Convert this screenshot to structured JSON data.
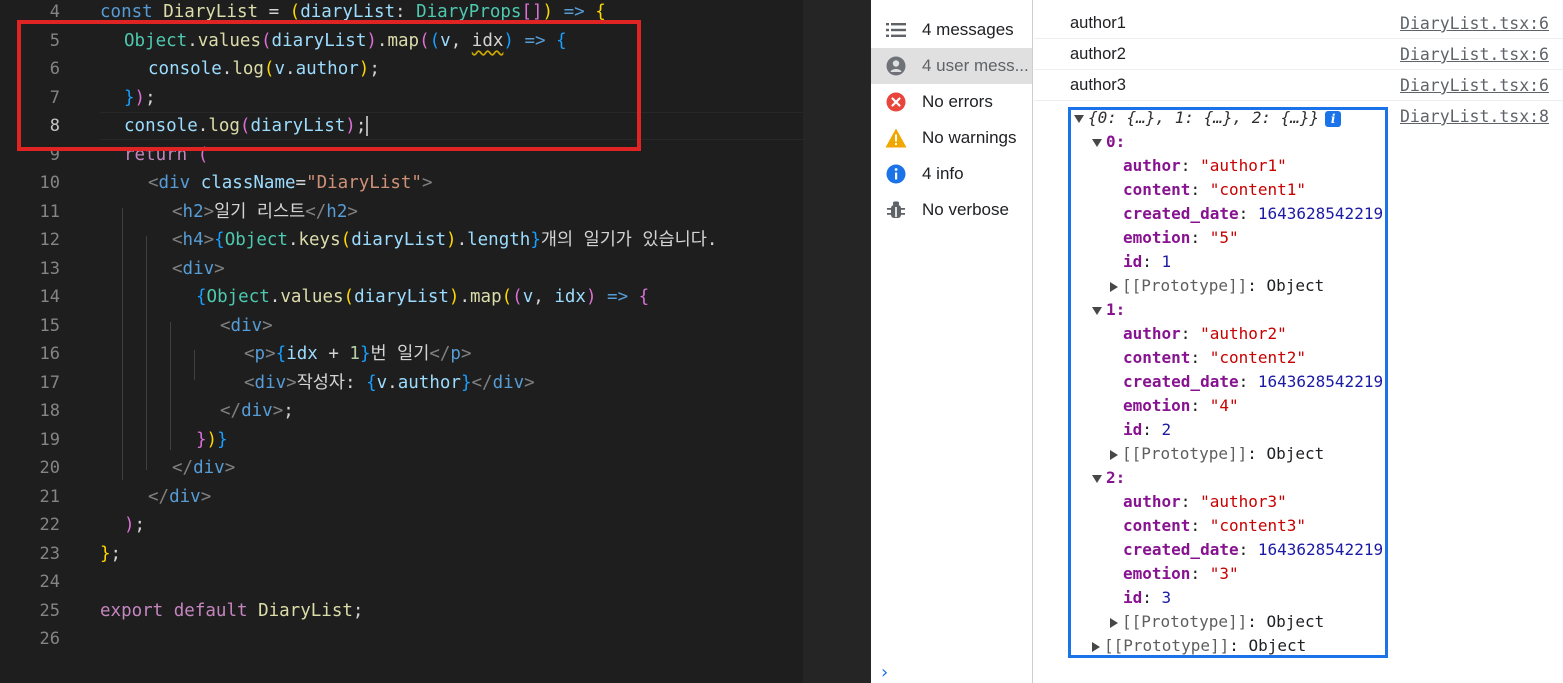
{
  "editor": {
    "lines": [
      {
        "n": "4",
        "segs": [
          [
            "kw",
            "const "
          ],
          [
            "fn",
            "DiaryList"
          ],
          [
            "txt",
            " = "
          ],
          [
            "br1",
            "("
          ],
          [
            "var",
            "diaryList"
          ],
          [
            "txt",
            ": "
          ],
          [
            "typ",
            "DiaryProps"
          ],
          [
            "br2",
            "[]"
          ],
          [
            "br1",
            ")"
          ],
          [
            "txt",
            " "
          ],
          [
            "kw",
            "=>"
          ],
          [
            "txt",
            " "
          ],
          [
            "br1",
            "{"
          ]
        ]
      },
      {
        "n": "5",
        "segs": [
          [
            "typ",
            "Object"
          ],
          [
            "txt",
            "."
          ],
          [
            "fn",
            "values"
          ],
          [
            "br2",
            "("
          ],
          [
            "var",
            "diaryList"
          ],
          [
            "br2",
            ")"
          ],
          [
            "txt",
            "."
          ],
          [
            "fn",
            "map"
          ],
          [
            "br2",
            "("
          ],
          [
            "br3",
            "("
          ],
          [
            "var",
            "v"
          ],
          [
            "txt",
            ", "
          ],
          [
            "squig",
            "idx"
          ],
          [
            "br3",
            ")"
          ],
          [
            "txt",
            " "
          ],
          [
            "kw",
            "=>"
          ],
          [
            "txt",
            " "
          ],
          [
            "br3",
            "{"
          ]
        ]
      },
      {
        "n": "6",
        "segs": [
          [
            "var",
            "console"
          ],
          [
            "txt",
            "."
          ],
          [
            "fn",
            "log"
          ],
          [
            "br1",
            "("
          ],
          [
            "var",
            "v"
          ],
          [
            "txt",
            "."
          ],
          [
            "var",
            "author"
          ],
          [
            "br1",
            ")"
          ],
          [
            "txt",
            ";"
          ]
        ]
      },
      {
        "n": "7",
        "segs": [
          [
            "br3",
            "}"
          ],
          [
            "br2",
            ")"
          ],
          [
            "txt",
            ";"
          ]
        ]
      },
      {
        "n": "8",
        "segs": [
          [
            "var",
            "console"
          ],
          [
            "txt",
            "."
          ],
          [
            "fn",
            "log"
          ],
          [
            "br2",
            "("
          ],
          [
            "var",
            "diaryList"
          ],
          [
            "br2",
            ")"
          ],
          [
            "txt",
            ";"
          ],
          [
            "cursor",
            ""
          ]
        ]
      },
      {
        "n": "9",
        "segs": [
          [
            "kw2",
            "return"
          ],
          [
            "txt",
            " "
          ],
          [
            "br2",
            "("
          ]
        ]
      },
      {
        "n": "10",
        "segs": [
          [
            "tagb",
            "<"
          ],
          [
            "tag",
            "div"
          ],
          [
            "txt",
            " "
          ],
          [
            "var",
            "className"
          ],
          [
            "txt",
            "="
          ],
          [
            "str",
            "\"DiaryList\""
          ],
          [
            "tagb",
            ">"
          ]
        ]
      },
      {
        "n": "11",
        "segs": [
          [
            "tagb",
            "<"
          ],
          [
            "tag",
            "h2"
          ],
          [
            "tagb",
            ">"
          ],
          [
            "txt",
            "일기 리스트"
          ],
          [
            "tagb",
            "</"
          ],
          [
            "tag",
            "h2"
          ],
          [
            "tagb",
            ">"
          ]
        ]
      },
      {
        "n": "12",
        "segs": [
          [
            "tagb",
            "<"
          ],
          [
            "tag",
            "h4"
          ],
          [
            "tagb",
            ">"
          ],
          [
            "br3",
            "{"
          ],
          [
            "typ",
            "Object"
          ],
          [
            "txt",
            "."
          ],
          [
            "fn",
            "keys"
          ],
          [
            "br1",
            "("
          ],
          [
            "var",
            "diaryList"
          ],
          [
            "br1",
            ")"
          ],
          [
            "txt",
            "."
          ],
          [
            "var",
            "length"
          ],
          [
            "br3",
            "}"
          ],
          [
            "txt",
            "개의 일기가 있습니다."
          ]
        ]
      },
      {
        "n": "13",
        "segs": [
          [
            "tagb",
            "<"
          ],
          [
            "tag",
            "div"
          ],
          [
            "tagb",
            ">"
          ]
        ]
      },
      {
        "n": "14",
        "segs": [
          [
            "br3",
            "{"
          ],
          [
            "typ",
            "Object"
          ],
          [
            "txt",
            "."
          ],
          [
            "fn",
            "values"
          ],
          [
            "br1",
            "("
          ],
          [
            "var",
            "diaryList"
          ],
          [
            "br1",
            ")"
          ],
          [
            "txt",
            "."
          ],
          [
            "fn",
            "map"
          ],
          [
            "br1",
            "("
          ],
          [
            "br2",
            "("
          ],
          [
            "var",
            "v"
          ],
          [
            "txt",
            ", "
          ],
          [
            "var",
            "idx"
          ],
          [
            "br2",
            ")"
          ],
          [
            "txt",
            " "
          ],
          [
            "kw",
            "=>"
          ],
          [
            "txt",
            " "
          ],
          [
            "br2",
            "{"
          ]
        ]
      },
      {
        "n": "15",
        "segs": [
          [
            "tagb",
            "<"
          ],
          [
            "tag",
            "div"
          ],
          [
            "tagb",
            ">"
          ]
        ]
      },
      {
        "n": "16",
        "segs": [
          [
            "tagb",
            "<"
          ],
          [
            "tag",
            "p"
          ],
          [
            "tagb",
            ">"
          ],
          [
            "br3",
            "{"
          ],
          [
            "var",
            "idx"
          ],
          [
            "txt",
            " + "
          ],
          [
            "num",
            "1"
          ],
          [
            "br3",
            "}"
          ],
          [
            "txt",
            "번 일기"
          ],
          [
            "tagb",
            "</"
          ],
          [
            "tag",
            "p"
          ],
          [
            "tagb",
            ">"
          ]
        ]
      },
      {
        "n": "17",
        "segs": [
          [
            "tagb",
            "<"
          ],
          [
            "tag",
            "div"
          ],
          [
            "tagb",
            ">"
          ],
          [
            "txt",
            "작성자: "
          ],
          [
            "br3",
            "{"
          ],
          [
            "var",
            "v"
          ],
          [
            "txt",
            "."
          ],
          [
            "var",
            "author"
          ],
          [
            "br3",
            "}"
          ],
          [
            "tagb",
            "</"
          ],
          [
            "tag",
            "div"
          ],
          [
            "tagb",
            ">"
          ]
        ]
      },
      {
        "n": "18",
        "segs": [
          [
            "tagb",
            "</"
          ],
          [
            "tag",
            "div"
          ],
          [
            "tagb",
            ">"
          ],
          [
            "txt",
            ";"
          ]
        ]
      },
      {
        "n": "19",
        "segs": [
          [
            "br2",
            "}"
          ],
          [
            "br1",
            ")"
          ],
          [
            "br3",
            "}"
          ]
        ]
      },
      {
        "n": "20",
        "segs": [
          [
            "tagb",
            "</"
          ],
          [
            "tag",
            "div"
          ],
          [
            "tagb",
            ">"
          ]
        ]
      },
      {
        "n": "21",
        "segs": [
          [
            "tagb",
            "</"
          ],
          [
            "tag",
            "div"
          ],
          [
            "tagb",
            ">"
          ]
        ]
      },
      {
        "n": "22",
        "segs": [
          [
            "br2",
            ")"
          ],
          [
            "txt",
            ";"
          ]
        ]
      },
      {
        "n": "23",
        "segs": [
          [
            "br1",
            "}"
          ],
          [
            "txt",
            ";"
          ]
        ]
      },
      {
        "n": "24",
        "segs": []
      },
      {
        "n": "25",
        "segs": [
          [
            "kw2",
            "export"
          ],
          [
            "txt",
            " "
          ],
          [
            "kw2",
            "default"
          ],
          [
            "txt",
            " "
          ],
          [
            "fn",
            "DiaryList"
          ],
          [
            "txt",
            ";"
          ]
        ]
      },
      {
        "n": "26",
        "segs": []
      }
    ]
  },
  "sidebar": {
    "items": [
      {
        "label": "4 messages",
        "icon": "list-icon"
      },
      {
        "label": "4 user mess...",
        "icon": "user-icon"
      },
      {
        "label": "No errors",
        "icon": "error-icon"
      },
      {
        "label": "No warnings",
        "icon": "warning-icon"
      },
      {
        "label": "4 info",
        "icon": "info-icon"
      },
      {
        "label": "No verbose",
        "icon": "bug-icon"
      }
    ]
  },
  "console": {
    "logs": [
      {
        "text": "author1",
        "source": "DiaryList.tsx:6"
      },
      {
        "text": "author2",
        "source": "DiaryList.tsx:6"
      },
      {
        "text": "author3",
        "source": "DiaryList.tsx:6"
      }
    ],
    "object_source": "DiaryList.tsx:8",
    "object_preview": "{0: {…}, 1: {…}, 2: {…}}",
    "info_badge": "i",
    "entries": [
      {
        "key": "0:",
        "author": "\"author1\"",
        "content": "\"content1\"",
        "created_date": "1643628542219",
        "emotion": "\"5\"",
        "id": "1"
      },
      {
        "key": "1:",
        "author": "\"author2\"",
        "content": "\"content2\"",
        "created_date": "1643628542219",
        "emotion": "\"4\"",
        "id": "2"
      },
      {
        "key": "2:",
        "author": "\"author3\"",
        "content": "\"content3\"",
        "created_date": "1643628542219",
        "emotion": "\"3\"",
        "id": "3"
      }
    ],
    "labels": {
      "author": "author",
      "content": "content",
      "created_date": "created_date",
      "emotion": "emotion",
      "id": "id",
      "colon": ": ",
      "prototype_key": "[[Prototype]]",
      "prototype_val": "Object"
    },
    "prompt": "›"
  },
  "colors": {
    "highlight_red": "#e02424",
    "highlight_blue": "#1a73e8"
  }
}
